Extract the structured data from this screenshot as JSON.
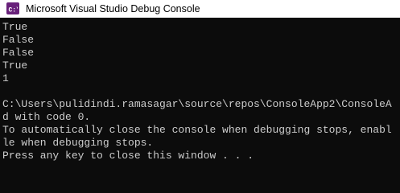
{
  "window": {
    "title": "Microsoft Visual Studio Debug Console",
    "icon": "vs-console-icon"
  },
  "console": {
    "lines": [
      "True",
      "False",
      "False",
      "True",
      "1",
      "",
      "C:\\Users\\pulidindi.ramasagar\\source\\repos\\ConsoleApp2\\ConsoleA",
      "d with code 0.",
      "To automatically close the console when debugging stops, enabl",
      "le when debugging stops.",
      "Press any key to close this window . . ."
    ]
  },
  "colors": {
    "console_background": "#0c0c0c",
    "console_text": "#cccccc",
    "titlebar_background": "#ffffff",
    "icon_background": "#68217a"
  }
}
